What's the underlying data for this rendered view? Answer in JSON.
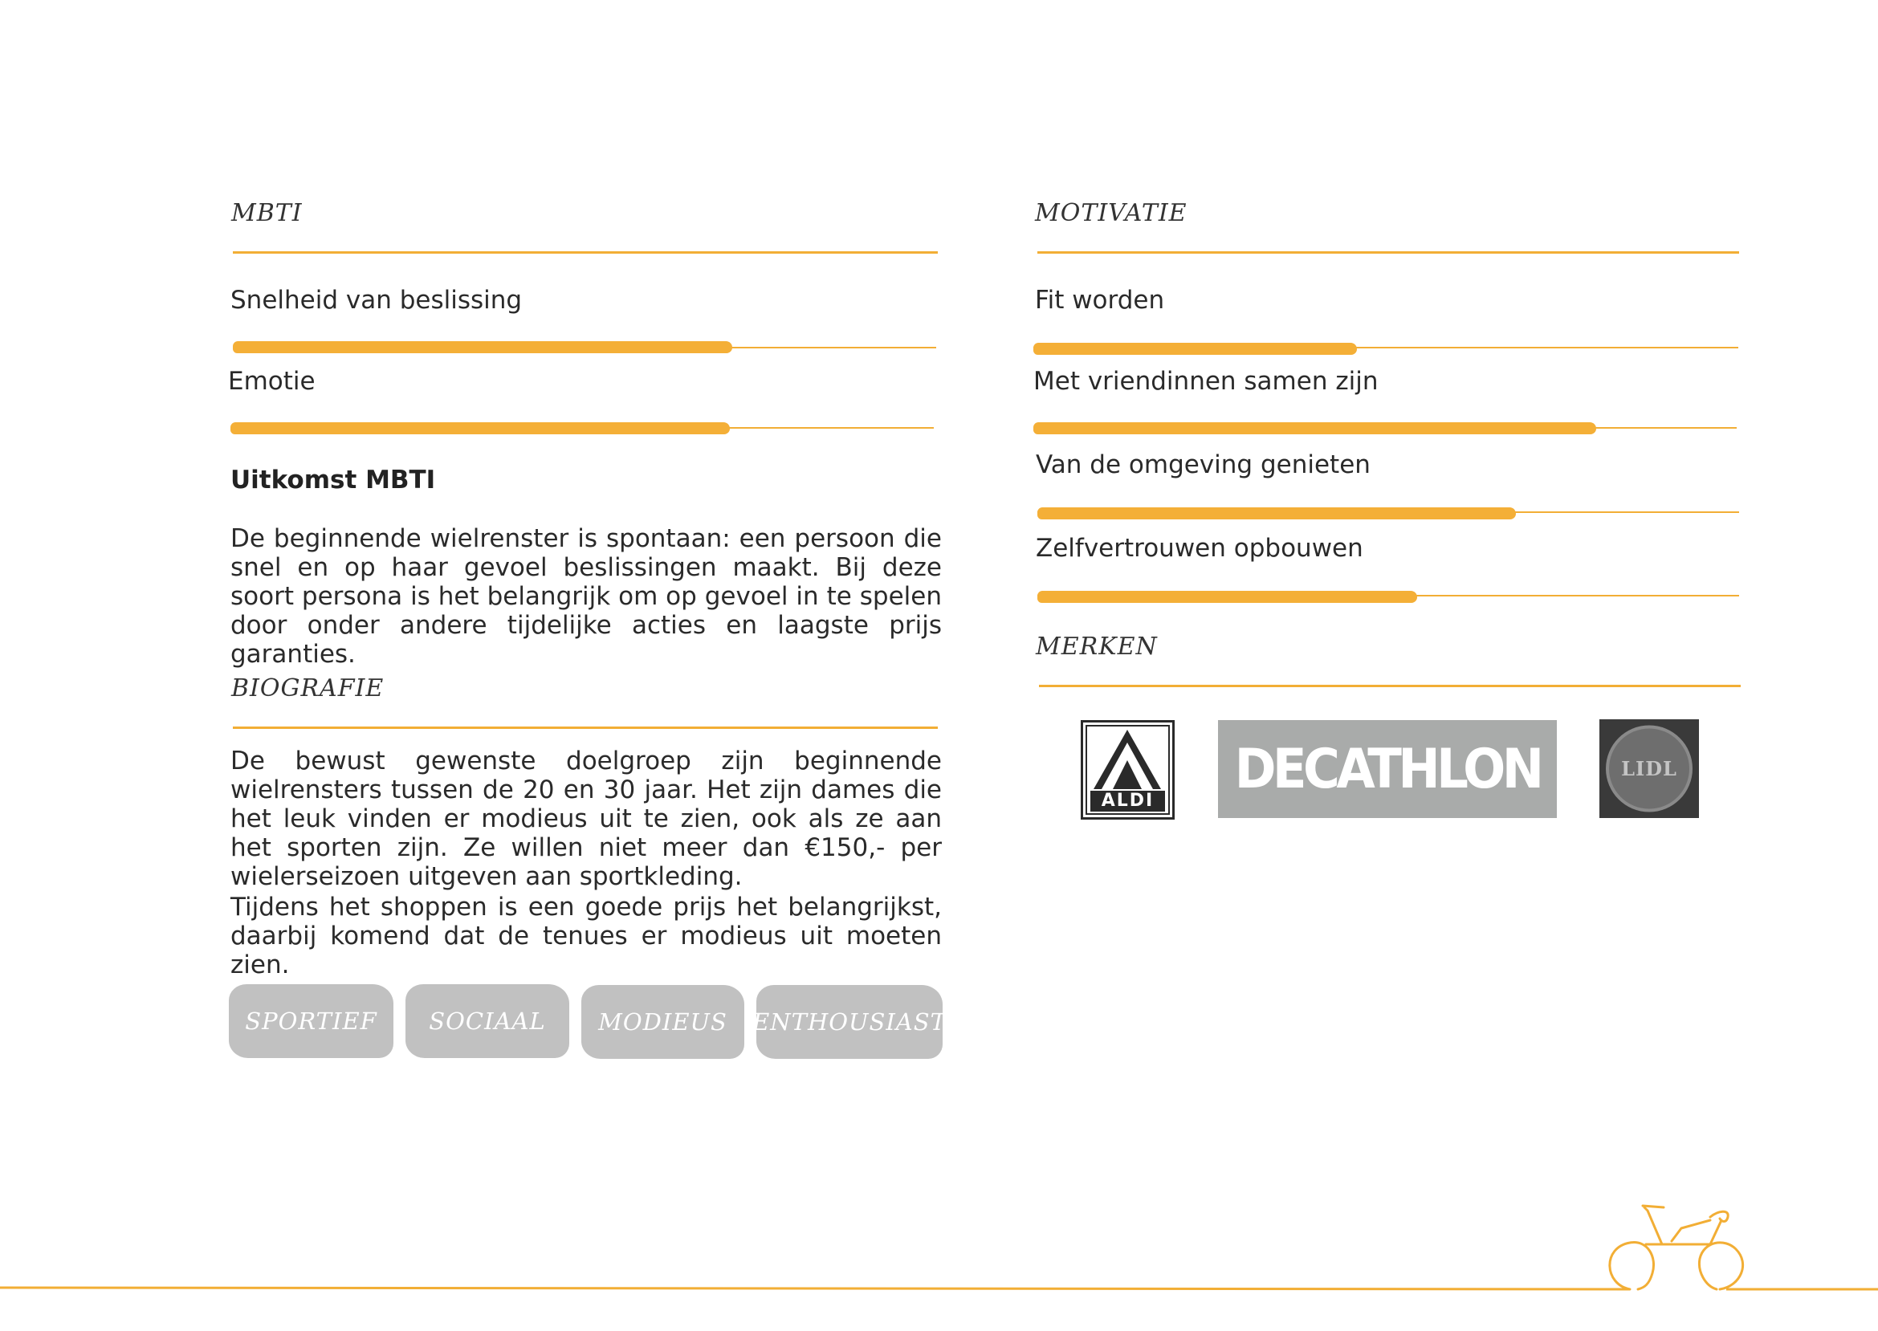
{
  "mbti": {
    "heading": "MBTI",
    "scales": [
      {
        "label": "Snelheid van beslissing",
        "value": 0.71
      },
      {
        "label": "Emotie",
        "value": 0.71
      }
    ],
    "result_title": "Uitkomst MBTI",
    "result_text": "De beginnende wielrenster is spontaan: een persoon die snel en op haar gevoel beslissingen maakt. Bij deze soort persona is het belangrijk om op gevoel in te spelen door onder andere tijdelijke acties en laagste prijs garanties."
  },
  "biografie": {
    "heading": "BIOGRAFIE",
    "paragraphs": [
      "De bewust gewenste doelgroep zijn beginnende wielrensters tussen de 20 en 30 jaar. Het zijn dames die het leuk vinden er modieus uit te zien, ook als ze aan het sporten zijn. Ze willen niet meer dan €150,- per wielerseizoen uitgeven aan sportkleding.",
      "Tijdens het shoppen is een goede prijs het belangrijkst, daarbij komend dat de tenues er modieus uit moeten zien."
    ],
    "tags": [
      "SPORTIEF",
      "SOCIAAL",
      "MODIEUS",
      "ENTHOUSIAST"
    ]
  },
  "motivatie": {
    "heading": "MOTIVATIE",
    "scales": [
      {
        "label": "Fit worden",
        "value": 0.46
      },
      {
        "label": "Met vriendinnen samen zijn",
        "value": 0.8
      },
      {
        "label": "Van de omgeving genieten",
        "value": 0.68
      },
      {
        "label": "Zelfvertrouwen opbouwen",
        "value": 0.54
      }
    ]
  },
  "merken": {
    "heading": "MERKEN",
    "brands": [
      "ALDI",
      "DECATHLON",
      "LIDL"
    ]
  },
  "colors": {
    "accent": "#f4af37",
    "tag": "#c1c1c1",
    "decathlon": "#a9abaa",
    "lidl": "#3a3a3a"
  },
  "icons": [
    "bicycle-icon"
  ]
}
